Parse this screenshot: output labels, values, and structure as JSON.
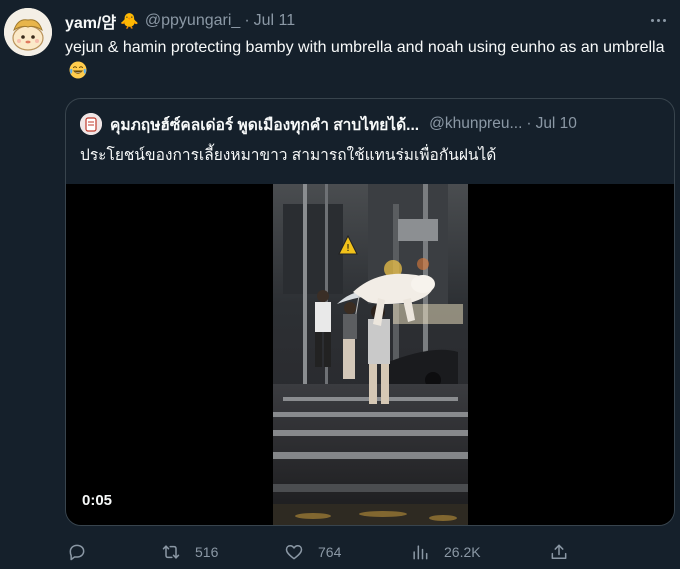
{
  "author": {
    "display_name": "yam/얌",
    "badge_emoji": "🐥",
    "handle": "@ppyungari_",
    "separator": "·",
    "time": "Jul 11"
  },
  "tweet": {
    "text": "yejun & hamin protecting bamby with umbrella and noah using eunho as an umbrella",
    "emoji": "😂"
  },
  "quoted": {
    "display_name": "คุมภฤษฮ์ซ์คลเด่อร์ พูดเมืองทุกคำ สาบไทยได้...",
    "handle": "@khunpreu...",
    "separator": "·",
    "time": "Jul 10",
    "text": "ประโยชน์ของการเลี้ยงหมาขาว สามารถใช้แทนร่มเพื่อกันฝนได้",
    "video": {
      "duration": "0:05"
    }
  },
  "actions": {
    "reply_count": "",
    "retweet_count": "516",
    "like_count": "764",
    "views_count": "26.2K"
  },
  "icons": [
    "more-icon",
    "reply-icon",
    "retweet-icon",
    "like-icon",
    "views-icon",
    "share-icon"
  ],
  "colors": {
    "background": "#15202b",
    "border": "#38444d",
    "secondary_text": "#8b98a5",
    "primary_text": "#f7f9f9"
  }
}
